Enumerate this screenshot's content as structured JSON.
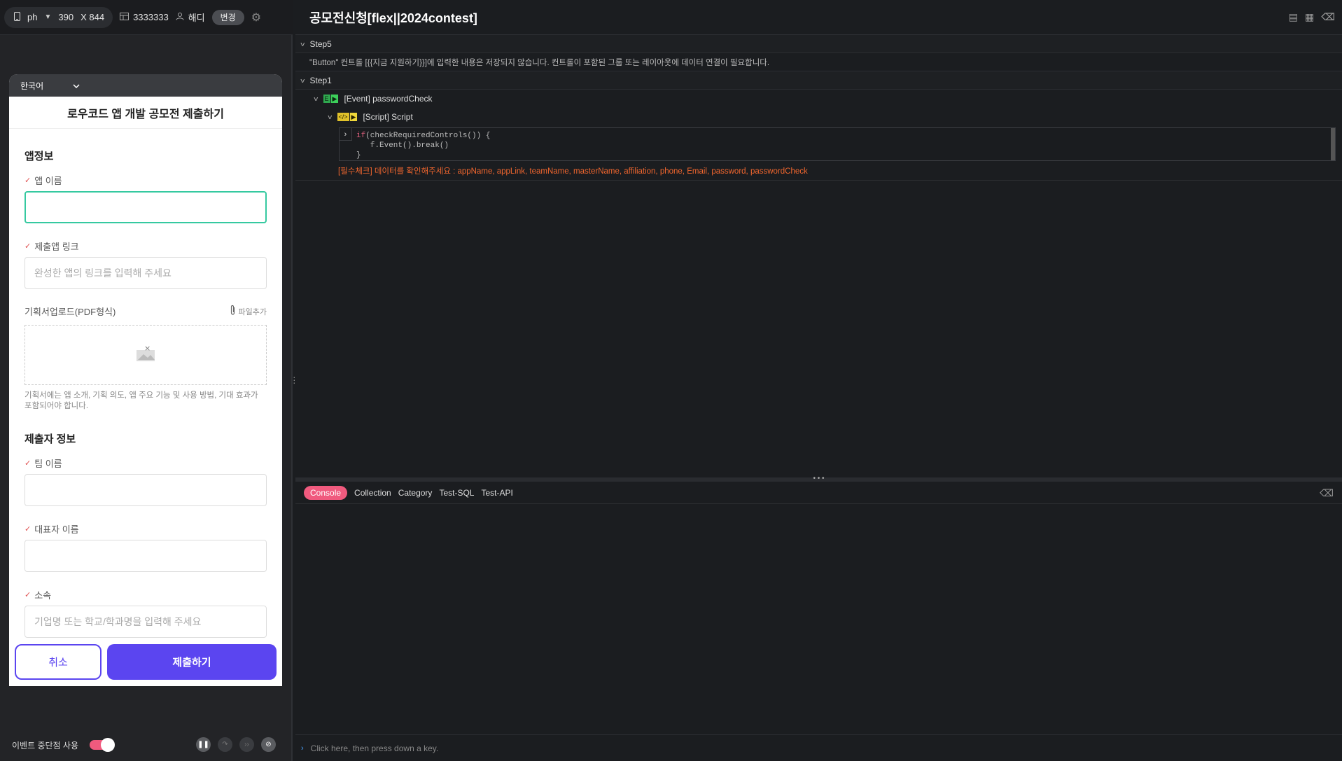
{
  "topbar": {
    "device": "ph",
    "width": "390",
    "height_label": "X 844",
    "id_value": "3333333",
    "user": "해디",
    "change_btn": "변경"
  },
  "phone": {
    "language": "한국어",
    "title": "로우코드 앱 개발 공모전 제출하기",
    "section_app": "앱정보",
    "app_name_label": "앱 이름",
    "app_name_value": "",
    "app_link_label": "제출앱 링크",
    "app_link_placeholder": "완성한 앱의 링크를 입력해 주세요",
    "upload_label": "기획서업로드(PDF형식)",
    "upload_add": "파일추가",
    "upload_hint": "기획서에는 앱 소개, 기획 의도, 앱 주요 기능 및 사용 방법, 기대 효과가 포함되어야 합니다.",
    "section_submitter": "제출자 정보",
    "team_label": "팀 이름",
    "rep_label": "대표자 이름",
    "affil_label": "소속",
    "affil_placeholder": "기업명 또는 학교/학과명을 입력해 주세요",
    "cancel": "취소",
    "submit": "제출하기"
  },
  "bottom": {
    "breakpoint_label": "이벤트 중단점 사용"
  },
  "right": {
    "title": "공모전신청[flex||2024contest]",
    "step5": "Step5",
    "step5_msg": "\"Button\" 컨트롤 [{{지금 지원하기}}]에 입력한 내용은 저장되지 않습니다. 컨트롤이 포함된 그룹 또는 레이아웃에 데이터 연결이 필요합니다.",
    "step1": "Step1",
    "event_item": "[Event] passwordCheck",
    "script_item": "[Script] Script",
    "code_kw": "if",
    "code_line1_rest": "(checkRequiredControls()) {",
    "code_line2": "   f.Event().break()",
    "code_line3": "}",
    "error": "[필수체크] 데이터를 확인해주세요 : appName, appLink, teamName, masterName, affiliation, phone, Email, password, passwordCheck"
  },
  "console": {
    "tabs": [
      "Console",
      "Collection",
      "Category",
      "Test-SQL",
      "Test-API"
    ],
    "input_placeholder": "Click here, then press down a key."
  }
}
